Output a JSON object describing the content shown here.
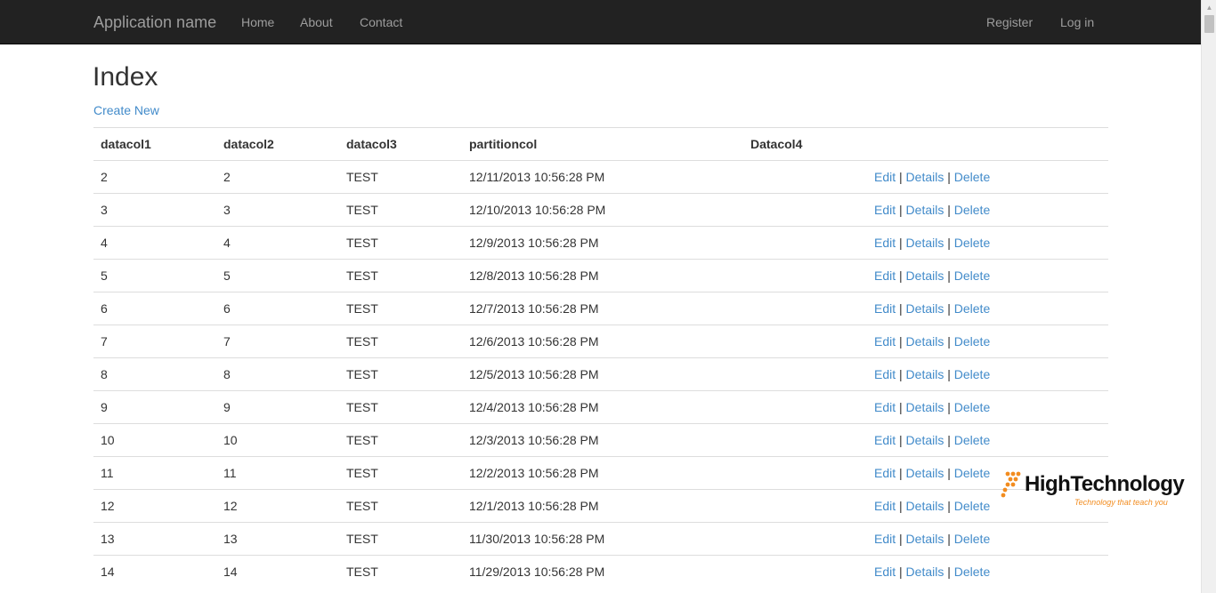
{
  "navbar": {
    "brand": "Application name",
    "links": [
      "Home",
      "About",
      "Contact"
    ],
    "right_links": [
      "Register",
      "Log in"
    ]
  },
  "page": {
    "title": "Index",
    "create_link": "Create New"
  },
  "table": {
    "headers": [
      "datacol1",
      "datacol2",
      "datacol3",
      "partitioncol",
      "Datacol4",
      ""
    ],
    "rows": [
      [
        "2",
        "2",
        "TEST",
        "12/11/2013 10:56:28 PM",
        ""
      ],
      [
        "3",
        "3",
        "TEST",
        "12/10/2013 10:56:28 PM",
        ""
      ],
      [
        "4",
        "4",
        "TEST",
        "12/9/2013 10:56:28 PM",
        ""
      ],
      [
        "5",
        "5",
        "TEST",
        "12/8/2013 10:56:28 PM",
        ""
      ],
      [
        "6",
        "6",
        "TEST",
        "12/7/2013 10:56:28 PM",
        ""
      ],
      [
        "7",
        "7",
        "TEST",
        "12/6/2013 10:56:28 PM",
        ""
      ],
      [
        "8",
        "8",
        "TEST",
        "12/5/2013 10:56:28 PM",
        ""
      ],
      [
        "9",
        "9",
        "TEST",
        "12/4/2013 10:56:28 PM",
        ""
      ],
      [
        "10",
        "10",
        "TEST",
        "12/3/2013 10:56:28 PM",
        ""
      ],
      [
        "11",
        "11",
        "TEST",
        "12/2/2013 10:56:28 PM",
        ""
      ],
      [
        "12",
        "12",
        "TEST",
        "12/1/2013 10:56:28 PM",
        ""
      ],
      [
        "13",
        "13",
        "TEST",
        "11/30/2013 10:56:28 PM",
        ""
      ],
      [
        "14",
        "14",
        "TEST",
        "11/29/2013 10:56:28 PM",
        ""
      ]
    ],
    "actions": {
      "edit": "Edit",
      "details": "Details",
      "delete": "Delete",
      "separator": "|"
    }
  },
  "watermark": {
    "title": "HighTechnology",
    "tagline": "Technology that teach you"
  },
  "colors": {
    "navbar_bg": "#222222",
    "nav_text": "#9d9d9d",
    "link": "#428bca",
    "watermark_accent": "#f28c1f"
  },
  "icons": [
    "scroll-up-arrow-icon",
    "watermark-logo-icon"
  ]
}
